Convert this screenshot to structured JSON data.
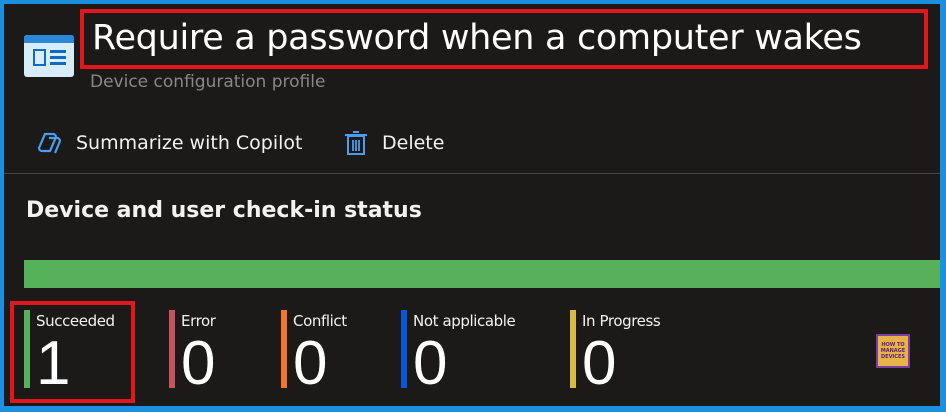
{
  "header": {
    "title": "Require a password when a computer wakes",
    "subtitle": "Device configuration profile",
    "icon": "config-profile-icon"
  },
  "toolbar": {
    "copilot_label": "Summarize with Copilot",
    "copilot_icon": "copilot-icon",
    "delete_label": "Delete",
    "delete_icon": "trash-icon"
  },
  "status": {
    "section_title": "Device and user check-in status",
    "progress_succeeded_fraction": 1.0,
    "progress_color": "#57b05a",
    "stats": [
      {
        "label": "Succeeded",
        "value": "1",
        "color": "#57b05a"
      },
      {
        "label": "Error",
        "value": "0",
        "color": "#c4555c"
      },
      {
        "label": "Conflict",
        "value": "0",
        "color": "#f0782b"
      },
      {
        "label": "Not applicable",
        "value": "0",
        "color": "#0a56d8"
      },
      {
        "label": "In Progress",
        "value": "0",
        "color": "#d8b94a"
      }
    ]
  },
  "watermark": {
    "line1": "HOW TO",
    "line2": "MANAGE",
    "line3": "DEVICES"
  },
  "colors": {
    "background": "#1b1a19",
    "border": "#1b8fe0",
    "accent": "#0f6cbd",
    "highlight": "#e3161d"
  }
}
